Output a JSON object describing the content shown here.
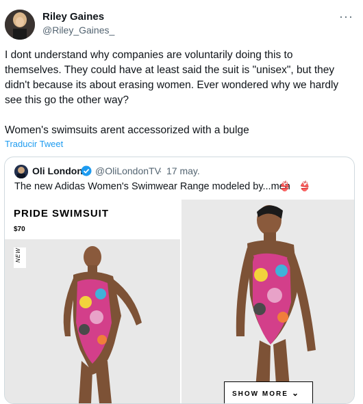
{
  "author": {
    "name": "Riley Gaines",
    "handle": "@Riley_Gaines_"
  },
  "more_label": "···",
  "tweet_text": "I dont understand why companies are voluntarily doing this to themselves. They could have at least said the suit is \"unisex\", but they didn't because its about erasing women. Ever wondered why we hardly see this go the other way?\n\nWomen's swimsuits arent accessorized with a bulge",
  "translate_label": "Traducir Tweet",
  "quoted": {
    "name": "Oli London",
    "handle": "@OliLondonTV",
    "separator": "·",
    "date": "17 may.",
    "text": "The new Adidas Women's Swimwear Range modeled by...men",
    "emojis": "👙 👙",
    "product": {
      "title": "PRIDE SWIMSUIT",
      "price": "$70",
      "tag": "NEW",
      "show_more": "SHOW MORE",
      "chevron": "⌄"
    }
  },
  "icons": [
    "avatar",
    "verified-badge-icon",
    "more-options-icon",
    "chevron-down-icon"
  ],
  "colors": {
    "link": "#1d9bf0",
    "muted": "#536471",
    "verified": "#1d9bf0"
  }
}
